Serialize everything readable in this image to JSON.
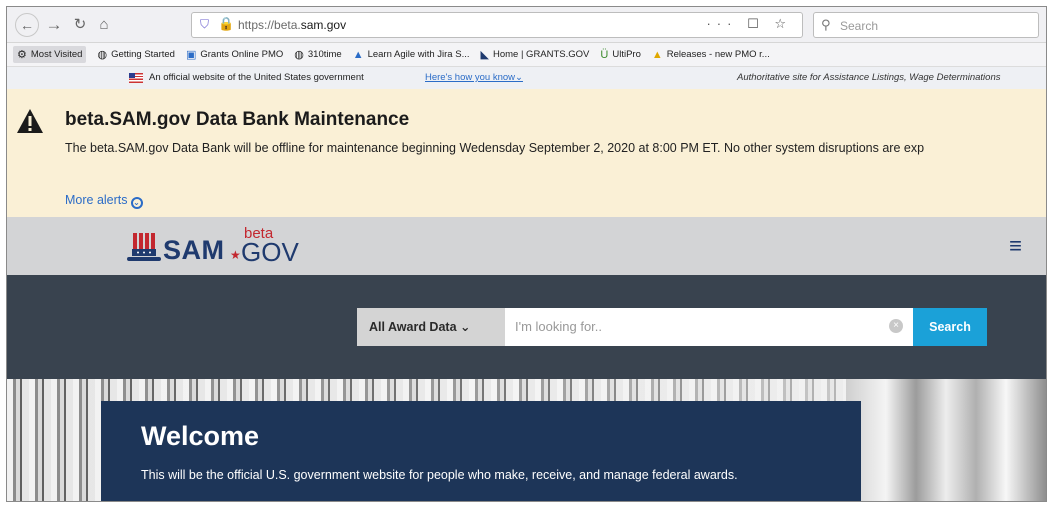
{
  "browser": {
    "url_prefix": "https://beta.",
    "url_domain": "sam.gov",
    "url_actions": "··· ☐ ☆",
    "search_placeholder": "Search"
  },
  "bookmarks": [
    {
      "label": "Most Visited",
      "icon": "⚙"
    },
    {
      "label": "Getting Started",
      "icon": "◍"
    },
    {
      "label": "Grants Online PMO",
      "icon": "▣"
    },
    {
      "label": "310time",
      "icon": "◍"
    },
    {
      "label": "Learn Agile with Jira S...",
      "icon": "▲"
    },
    {
      "label": "Home | GRANTS.GOV",
      "icon": "◣"
    },
    {
      "label": "UltiPro",
      "icon": "Ü"
    },
    {
      "label": "Releases - new PMO r...",
      "icon": "▲"
    }
  ],
  "gov_banner": {
    "text": "An official website of the United States government",
    "link": "Here's how you know⌄",
    "right_text": "Authoritative site for Assistance Listings, Wage Determinations"
  },
  "alert": {
    "title": "beta.SAM.gov Data Bank Maintenance",
    "body": "The beta.SAM.gov Data Bank will be offline for maintenance beginning Wedensday September 2, 2020 at 8:00 PM ET.  No other system disruptions are exp",
    "more_label": "More alerts"
  },
  "logo": {
    "sam": "SAM",
    "gov": "GOV",
    "beta": "beta"
  },
  "search": {
    "dropdown_label": "All Award Data",
    "placeholder": "I'm looking for..",
    "button_label": "Search"
  },
  "welcome": {
    "title": "Welcome",
    "text": "This will be the official U.S. government website for people who make, receive, and manage federal awards."
  },
  "colors": {
    "alert_bg": "#faf0d6",
    "sam_blue": "#1f3a6e",
    "search_band": "#39434f",
    "search_button": "#1ba1d8",
    "welcome_card": "#1d3558",
    "accent_red": "#c3272f"
  }
}
